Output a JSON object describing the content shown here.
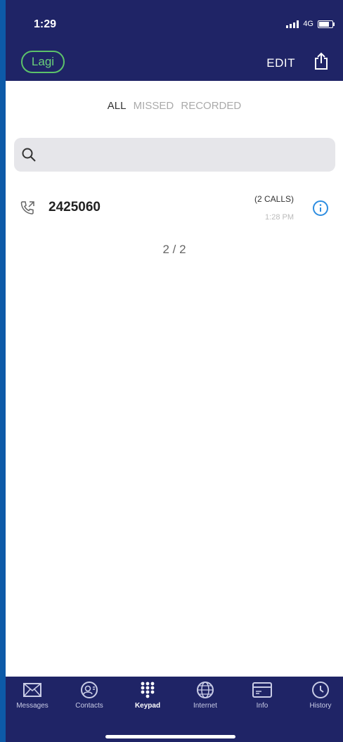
{
  "status": {
    "time": "1:29",
    "network": "4G"
  },
  "header": {
    "back_label": "Lagi",
    "edit_label": "EDIT"
  },
  "filters": {
    "all": "ALL",
    "missed": "MISSED",
    "recorded": "RECORDED"
  },
  "search": {
    "placeholder": ""
  },
  "calls": [
    {
      "number": "2425060",
      "count": "(2 CALLS)",
      "time": "1:28 PM"
    }
  ],
  "pagination": "2 / 2",
  "tabbar": {
    "items": [
      {
        "label": "Messages",
        "icon": "envelope-icon"
      },
      {
        "label": "Contacts",
        "icon": "contact-icon"
      },
      {
        "label": "Keypad",
        "icon": "keypad-icon",
        "active": true
      },
      {
        "label": "Internet",
        "icon": "globe-icon"
      },
      {
        "label": "Info",
        "icon": "card-icon"
      },
      {
        "label": "History",
        "icon": "clock-icon"
      }
    ]
  },
  "colors": {
    "nav_bg": "#1f2466",
    "accent_green": "#5cc26a",
    "info_blue": "#2d8de0",
    "side_bg": "#0d5aa8"
  }
}
